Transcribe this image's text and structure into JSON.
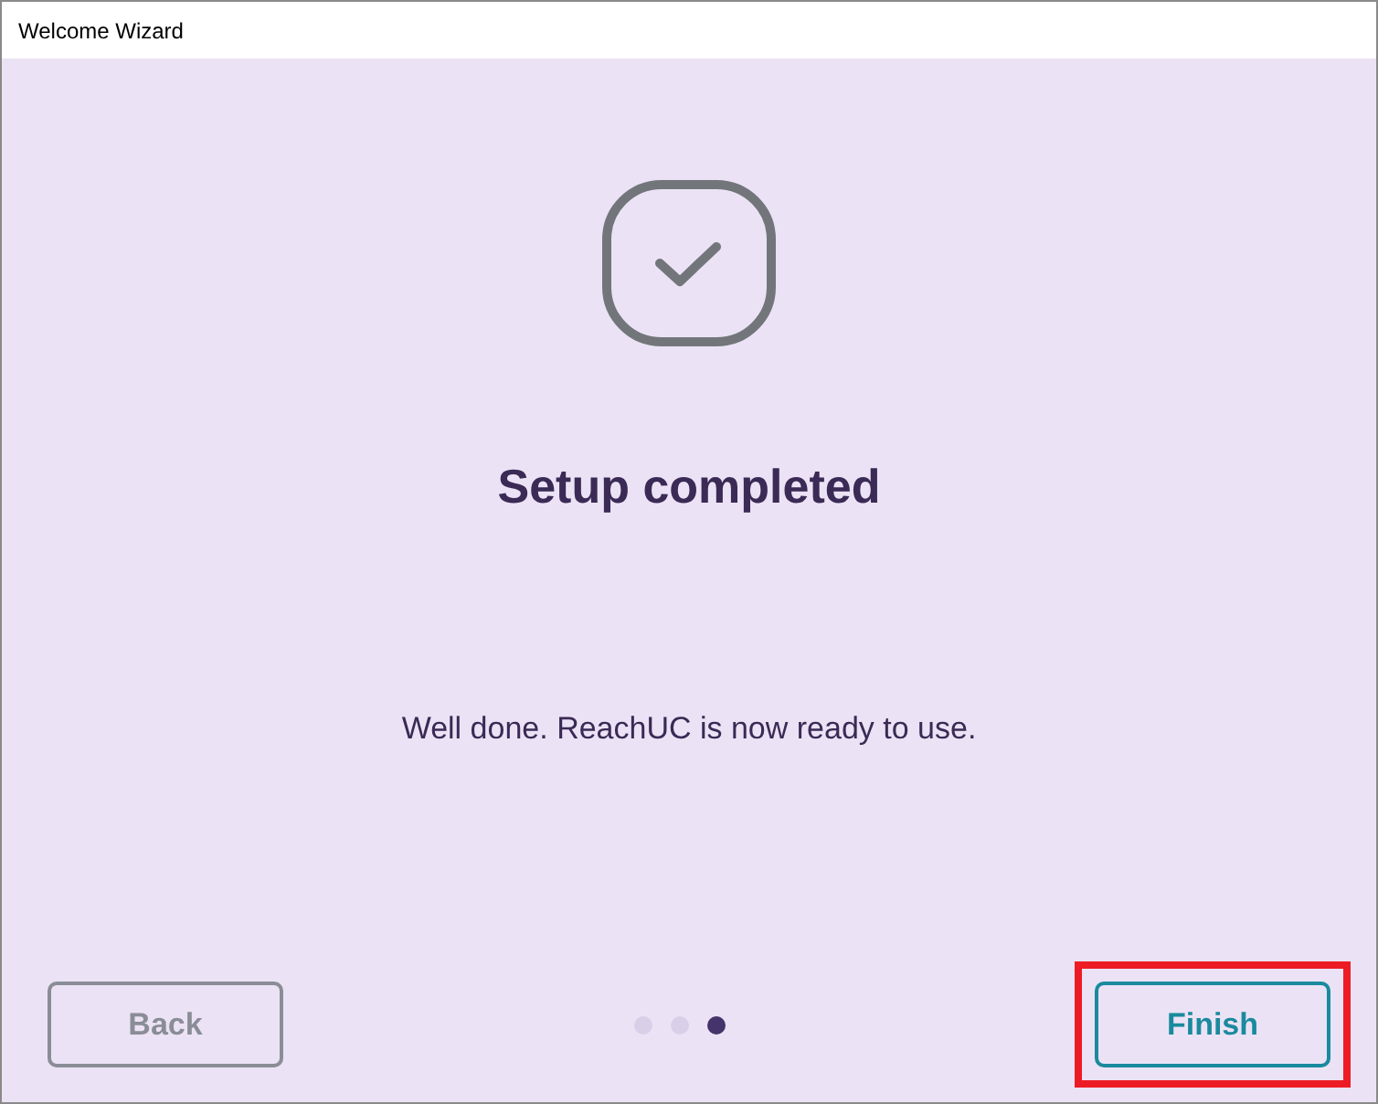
{
  "window": {
    "title": "Welcome Wizard"
  },
  "heading": "Setup completed",
  "message": "Well done. ReachUC is now ready to use.",
  "steps": [
    {
      "selected": false
    },
    {
      "selected": false
    },
    {
      "selected": true
    }
  ],
  "back_button": {
    "label": "Back",
    "disabled": true
  },
  "finish_button": {
    "label": "Finish",
    "highlighted": true
  }
}
